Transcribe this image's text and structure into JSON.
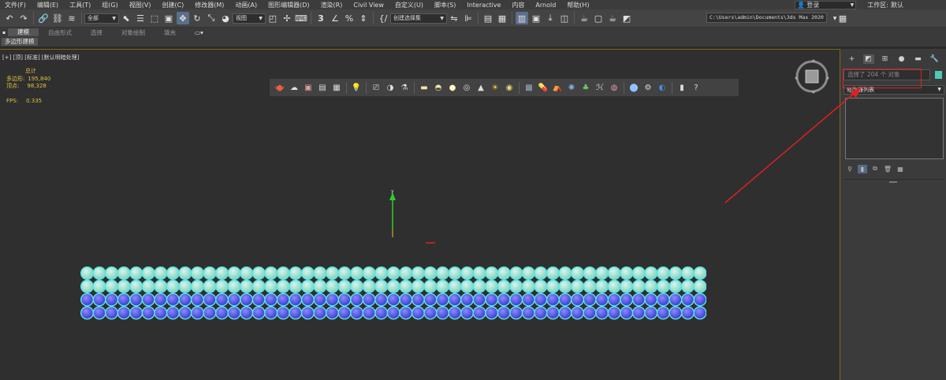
{
  "menubar": {
    "items": [
      "文件(F)",
      "编辑(E)",
      "工具(T)",
      "组(G)",
      "视图(V)",
      "创建(C)",
      "修改器(M)",
      "动画(A)",
      "图形编辑器(D)",
      "渲染(R)",
      "Civil View",
      "自定义(U)",
      "脚本(S)",
      "Interactive",
      "内容",
      "Arnold",
      "帮助(H)"
    ],
    "login_label": "登录",
    "workspace_label": "工作区:",
    "workspace_value": "默认"
  },
  "toolbar": {
    "filter_value": "全部",
    "refcoord_value": "视图",
    "selection_set_placeholder": "创建选择集",
    "project_path": "C:\\Users\\admin\\Documents\\3ds Max 2020"
  },
  "ribbon": {
    "tabs": [
      "建模",
      "自由形式",
      "选择",
      "对象绘制",
      "填充"
    ],
    "subtab": "多边形建模"
  },
  "viewport": {
    "label": "[+] [顶] [标准] [默认明暗处理]",
    "stats_title": "总计",
    "polys_label": "多边形:",
    "polys_value": "195,840",
    "verts_label": "顶点:",
    "verts_value": "98,328",
    "fps_label": "FPS:",
    "fps_value": "0.335",
    "axis_label": "y",
    "sphere_rows": [
      {
        "color": "#7fd3c2",
        "count": 51
      },
      {
        "color": "#7fd3c2",
        "count": 51
      },
      {
        "color": "#3a3ad0",
        "count": 51
      },
      {
        "color": "#3a3ad0",
        "count": 51
      }
    ]
  },
  "panel": {
    "selection_text": "选择了 204 个 对象",
    "modifier_list": "修改器列表",
    "object_color": "#4ec9b8"
  },
  "annotation": {
    "color": "#e02020"
  }
}
